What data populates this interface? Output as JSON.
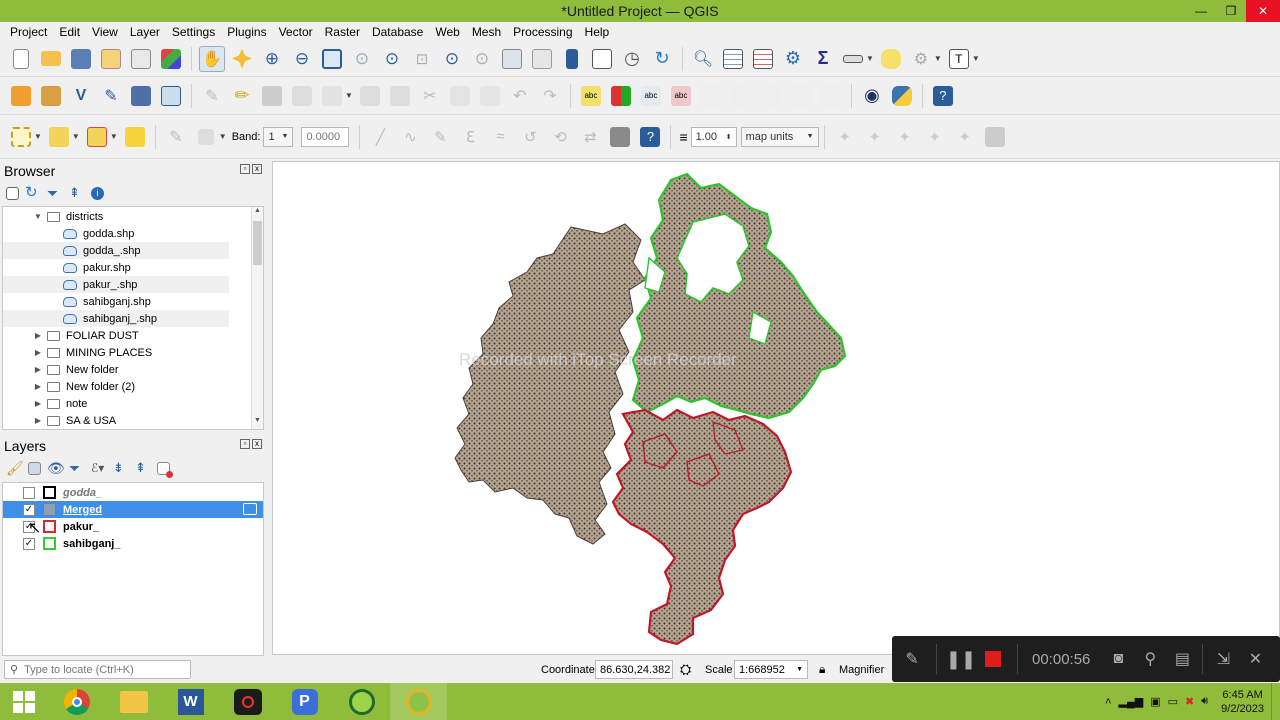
{
  "window": {
    "title": "*Untitled Project — QGIS",
    "minimize": "—",
    "maximize": "❐",
    "close": "✕"
  },
  "menu": [
    "Project",
    "Edit",
    "View",
    "Layer",
    "Settings",
    "Plugins",
    "Vector",
    "Raster",
    "Database",
    "Web",
    "Mesh",
    "Processing",
    "Help"
  ],
  "toolbar3": {
    "band_label": "Band:",
    "band_value": "1",
    "value_field": "0.0000",
    "width_value": "1.00",
    "units": "map units"
  },
  "browser": {
    "title": "Browser",
    "items": [
      {
        "label": "districts",
        "type": "folder",
        "expanded": true,
        "level": 0
      },
      {
        "label": "godda.shp",
        "type": "shp",
        "level": 1
      },
      {
        "label": "godda_.shp",
        "type": "shp",
        "level": 1
      },
      {
        "label": "pakur.shp",
        "type": "shp",
        "level": 1
      },
      {
        "label": "pakur_.shp",
        "type": "shp",
        "level": 1
      },
      {
        "label": "sahibganj.shp",
        "type": "shp",
        "level": 1
      },
      {
        "label": "sahibganj_.shp",
        "type": "shp",
        "level": 1
      },
      {
        "label": "FOLIAR DUST",
        "type": "folder",
        "level": 0
      },
      {
        "label": "MINING PLACES",
        "type": "folder",
        "level": 0
      },
      {
        "label": "New folder",
        "type": "folder",
        "level": 0
      },
      {
        "label": "New folder (2)",
        "type": "folder",
        "level": 0
      },
      {
        "label": "note",
        "type": "folder",
        "level": 0
      },
      {
        "label": "SA & USA",
        "type": "folder",
        "level": 0
      }
    ]
  },
  "layers": {
    "title": "Layers",
    "items": [
      {
        "label": "godda_",
        "checked": false,
        "color": "#000000",
        "fill": "#ffffff"
      },
      {
        "label": "Merged",
        "checked": true,
        "color": "#8b8b8b",
        "fill": "#c8b8a0",
        "selected": true
      },
      {
        "label": "pakur_",
        "checked": true,
        "color": "#d12b2b",
        "fill": "#ffffff"
      },
      {
        "label": "sahibganj_",
        "checked": true,
        "color": "#3cc83c",
        "fill": "#ffffff"
      }
    ]
  },
  "map": {
    "watermark": "Recorded with iTop Screen Recorder",
    "colors": {
      "fill": "#b5a48f",
      "pakur_outline": "#c0172a",
      "sahibganj_outline": "#2dc42d",
      "dots": "#3a3330"
    }
  },
  "status": {
    "locate_placeholder": "Type to locate (Ctrl+K)",
    "coordinate_label": "Coordinate",
    "coordinate_value": "86.630,24.382",
    "scale_label": "Scale",
    "scale_value": "1:668952",
    "magnifier_label": "Magnifier"
  },
  "recorder": {
    "time": "00:00:56"
  },
  "taskbar": {
    "time": "6:45 AM",
    "date": "9/2/2023",
    "apps": [
      "windows",
      "chrome",
      "file-explorer",
      "word",
      "screen-recorder",
      "p-app",
      "qgis-1",
      "qgis-2"
    ]
  }
}
